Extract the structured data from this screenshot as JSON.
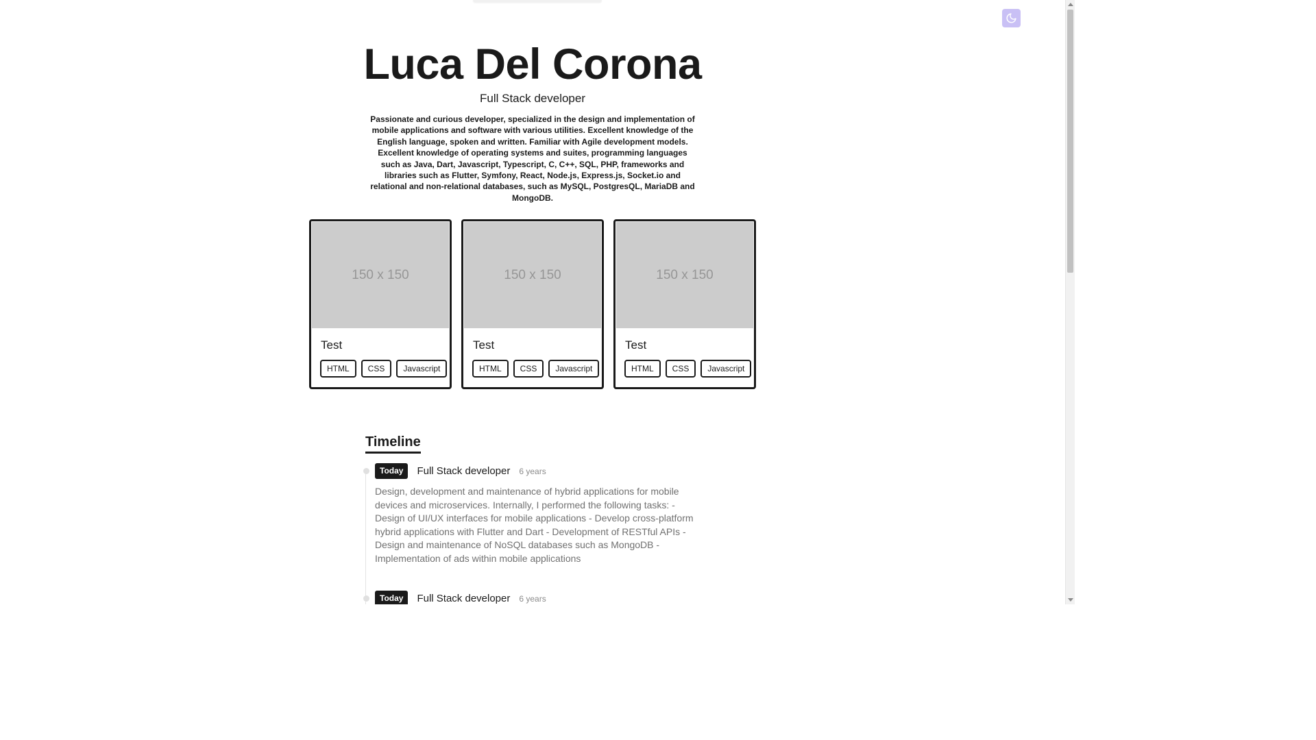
{
  "theme_toggle": {
    "icon": "moon-icon",
    "color": "#c9c0f5"
  },
  "hero": {
    "name": "Luca Del Corona",
    "role": "Full Stack developer",
    "bio": "Passionate and curious developer, specialized in the design and implementation of mobile applications and software with various utilities. Excellent knowledge of the English language, spoken and written. Familiar with Agile development models. Excellent knowledge of operating systems and suites, programming languages such as Java, Dart, Javascript, Typescript, C, C++, SQL, PHP, frameworks and libraries such as Flutter, Symfony, React, Node.js, Express.js, Socket.io and relational and non-relational databases, such as MySQL, PostgresQL, MariaDB and MongoDB."
  },
  "projects": [
    {
      "image_label": "150 x 150",
      "title": "Test",
      "tags": [
        "HTML",
        "CSS",
        "Javascript"
      ]
    },
    {
      "image_label": "150 x 150",
      "title": "Test",
      "tags": [
        "HTML",
        "CSS",
        "Javascript"
      ]
    },
    {
      "image_label": "150 x 150",
      "title": "Test",
      "tags": [
        "HTML",
        "CSS",
        "Javascript"
      ]
    }
  ],
  "timeline": {
    "heading": "Timeline",
    "entries": [
      {
        "badge": "Today",
        "title": "Full Stack developer",
        "duration": "6 years",
        "description": "Design, development and maintenance of hybrid applications for mobile devices and microservices. Internally, I performed the following tasks: - Design of UI/UX interfaces for mobile applications - Develop cross-platform hybrid applications with Flutter and Dart - Development of RESTful APIs - Design and maintenance of NoSQL databases such as MongoDB - Implementation of ads within mobile applications"
      },
      {
        "badge": "Today",
        "title": "Full Stack developer",
        "duration": "6 years",
        "description": ""
      }
    ]
  }
}
